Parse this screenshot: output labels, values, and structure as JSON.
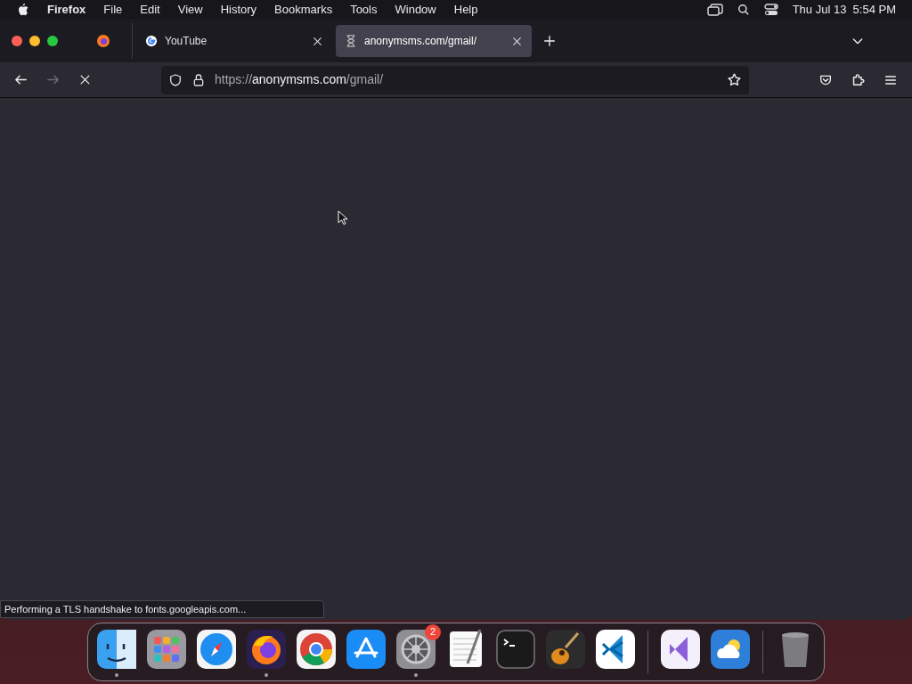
{
  "menu_bar": {
    "app": "Firefox",
    "items": [
      "File",
      "Edit",
      "View",
      "History",
      "Bookmarks",
      "Tools",
      "Window",
      "Help"
    ],
    "clock": "Thu Jul 13  5:54 PM"
  },
  "tabs": [
    {
      "title": "YouTube",
      "kind": "google",
      "selected": false
    },
    {
      "title": "anonymsms.com/gmail/",
      "kind": "loading",
      "selected": true
    }
  ],
  "toolbar": {
    "url": "https://**anonymsms.com**/gmail/",
    "forward_disabled": true,
    "loading": true
  },
  "status_text": "Performing a TLS handshake to fonts.googleapis.com...",
  "dock": [
    {
      "kind": "finder",
      "running": true
    },
    {
      "kind": "launchpad",
      "running": false
    },
    {
      "kind": "safari",
      "running": false
    },
    {
      "kind": "firefox",
      "running": true
    },
    {
      "kind": "chrome",
      "running": false
    },
    {
      "kind": "appstore",
      "running": false
    },
    {
      "kind": "settings",
      "running": true,
      "badge": "2"
    },
    {
      "kind": "textedit",
      "running": false
    },
    {
      "kind": "terminal",
      "running": false
    },
    {
      "kind": "guitar",
      "running": false
    },
    {
      "kind": "vscode",
      "running": false
    },
    {
      "kind": "divider"
    },
    {
      "kind": "vstudio",
      "running": false
    },
    {
      "kind": "weather",
      "running": false
    },
    {
      "kind": "divider"
    },
    {
      "kind": "trash",
      "running": false
    }
  ]
}
